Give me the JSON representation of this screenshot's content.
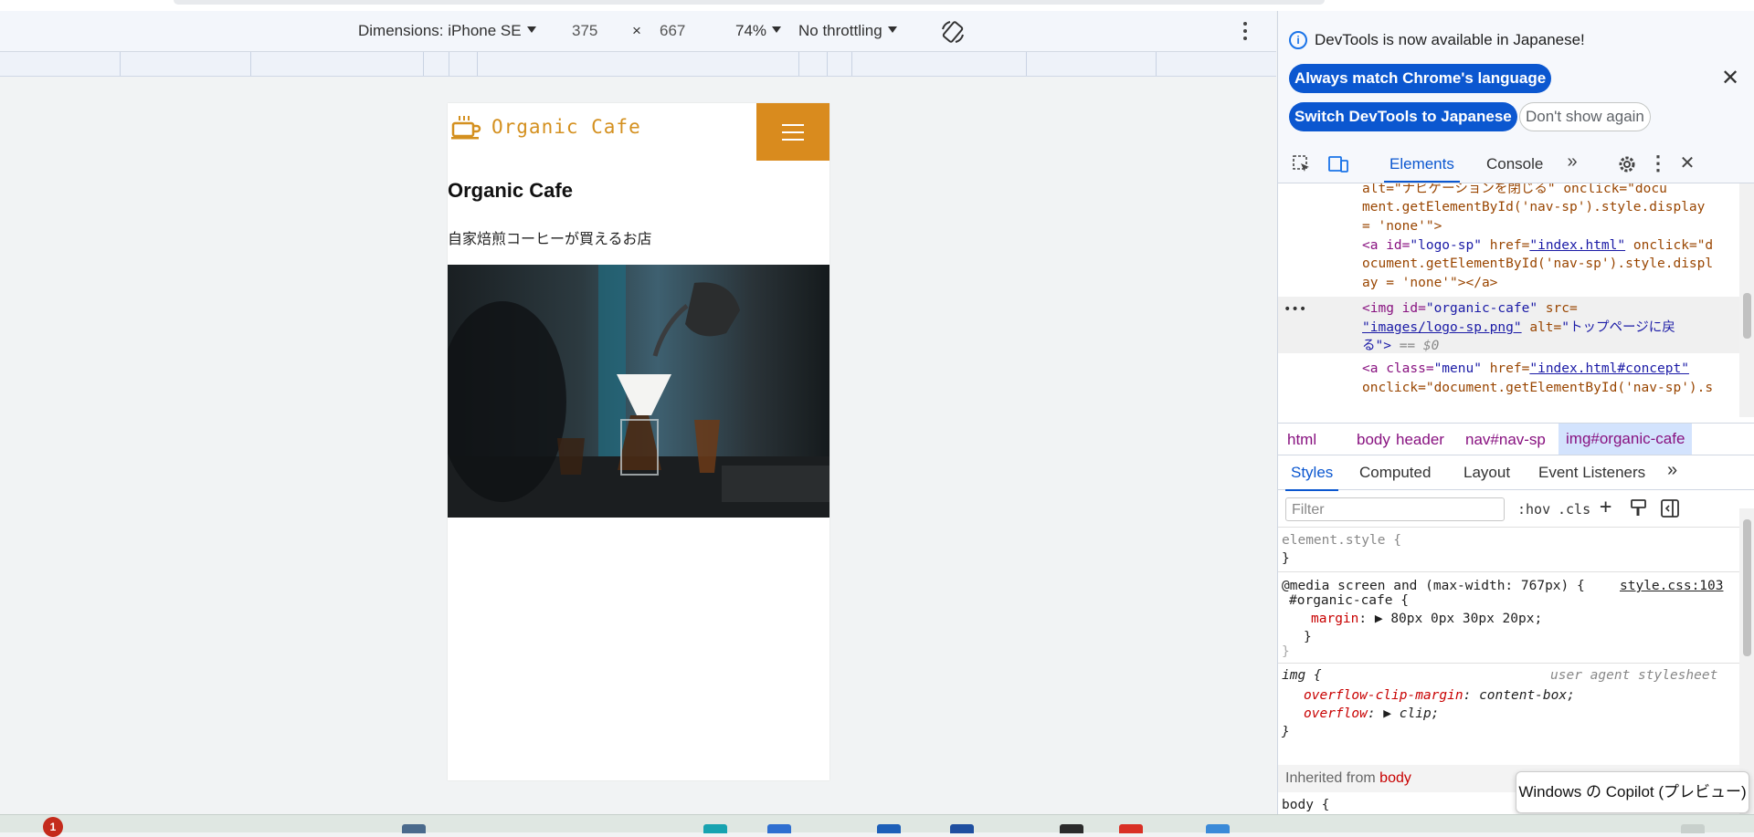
{
  "device_toolbar": {
    "dimensions_label": "Dimensions: iPhone SE",
    "width": "375",
    "times": "×",
    "height": "667",
    "zoom": "74%",
    "throttling": "No throttling"
  },
  "page": {
    "logo_text": "Organic Cafe",
    "title": "Organic Cafe",
    "subtitle": "自家焙煎コーヒーが買えるお店"
  },
  "devtools": {
    "banner": {
      "message": "DevTools is now available in Japanese!",
      "btn_match": "Always match Chrome's language",
      "btn_switch": "Switch DevTools to Japanese",
      "btn_dont_show": "Don't show again"
    },
    "tabs": {
      "elements": "Elements",
      "console": "Console"
    },
    "dom_lines": {
      "l0": "alt=\"ナビゲーションを閉じる\" onclick=\"docu",
      "l1": "ment.getElementById('nav-sp').style.display",
      "l2": "= 'none'\">",
      "l3a": "<a id=",
      "l3b": "\"logo-sp\"",
      "l3c": " href=",
      "l3d": "\"index.html\"",
      "l3e": " onclick=\"d",
      "l4": "ocument.getElementById('nav-sp').style.displ",
      "l5": "ay = 'none'\"></a>",
      "l6a": "<img id=",
      "l6b": "\"organic-cafe\"",
      "l6c": " src=",
      "l7a": "\"images/logo-sp.png\"",
      "l7b": " alt=",
      "l7c": "\"トップページに戻",
      "l8a": "る\">",
      "l8b": " == $0",
      "l9a": "<a class=",
      "l9b": "\"menu\"",
      "l9c": " href=",
      "l9d": "\"index.html#concept\"",
      "l10": "onclick=\"document.getElementById('nav-sp').s"
    },
    "breadcrumbs": [
      "html",
      "body",
      "header",
      "nav#nav-sp",
      "img#organic-cafe"
    ],
    "subtabs": {
      "styles": "Styles",
      "computed": "Computed",
      "layout": "Layout",
      "event_listeners": "Event Listeners"
    },
    "filter_placeholder": "Filter",
    "hov": ":hov",
    "cls": ".cls",
    "styles": {
      "element_style": "element.style {",
      "close_brace": "}",
      "media": "@media screen and (max-width: 767px) {",
      "source": "style.css:103",
      "selector": "#organic-cafe {",
      "margin_prop": "margin",
      "margin_val": "80px 0px 30px 20px;",
      "img_selector": "img {",
      "ua_label": "user agent stylesheet",
      "ua_p1": "overflow-clip-margin",
      "ua_v1": "content-box;",
      "ua_p2": "overflow",
      "ua_v2": "clip;",
      "inherited_label": "Inherited from",
      "inherited_from": "body",
      "body_selector": "body {"
    }
  },
  "tooltip": "Windows の Copilot (プレビュー)",
  "taskbar": {
    "badge": "1"
  },
  "colors": {
    "accent_orange": "#d98b1e",
    "devtools_blue": "#0b57d0"
  }
}
